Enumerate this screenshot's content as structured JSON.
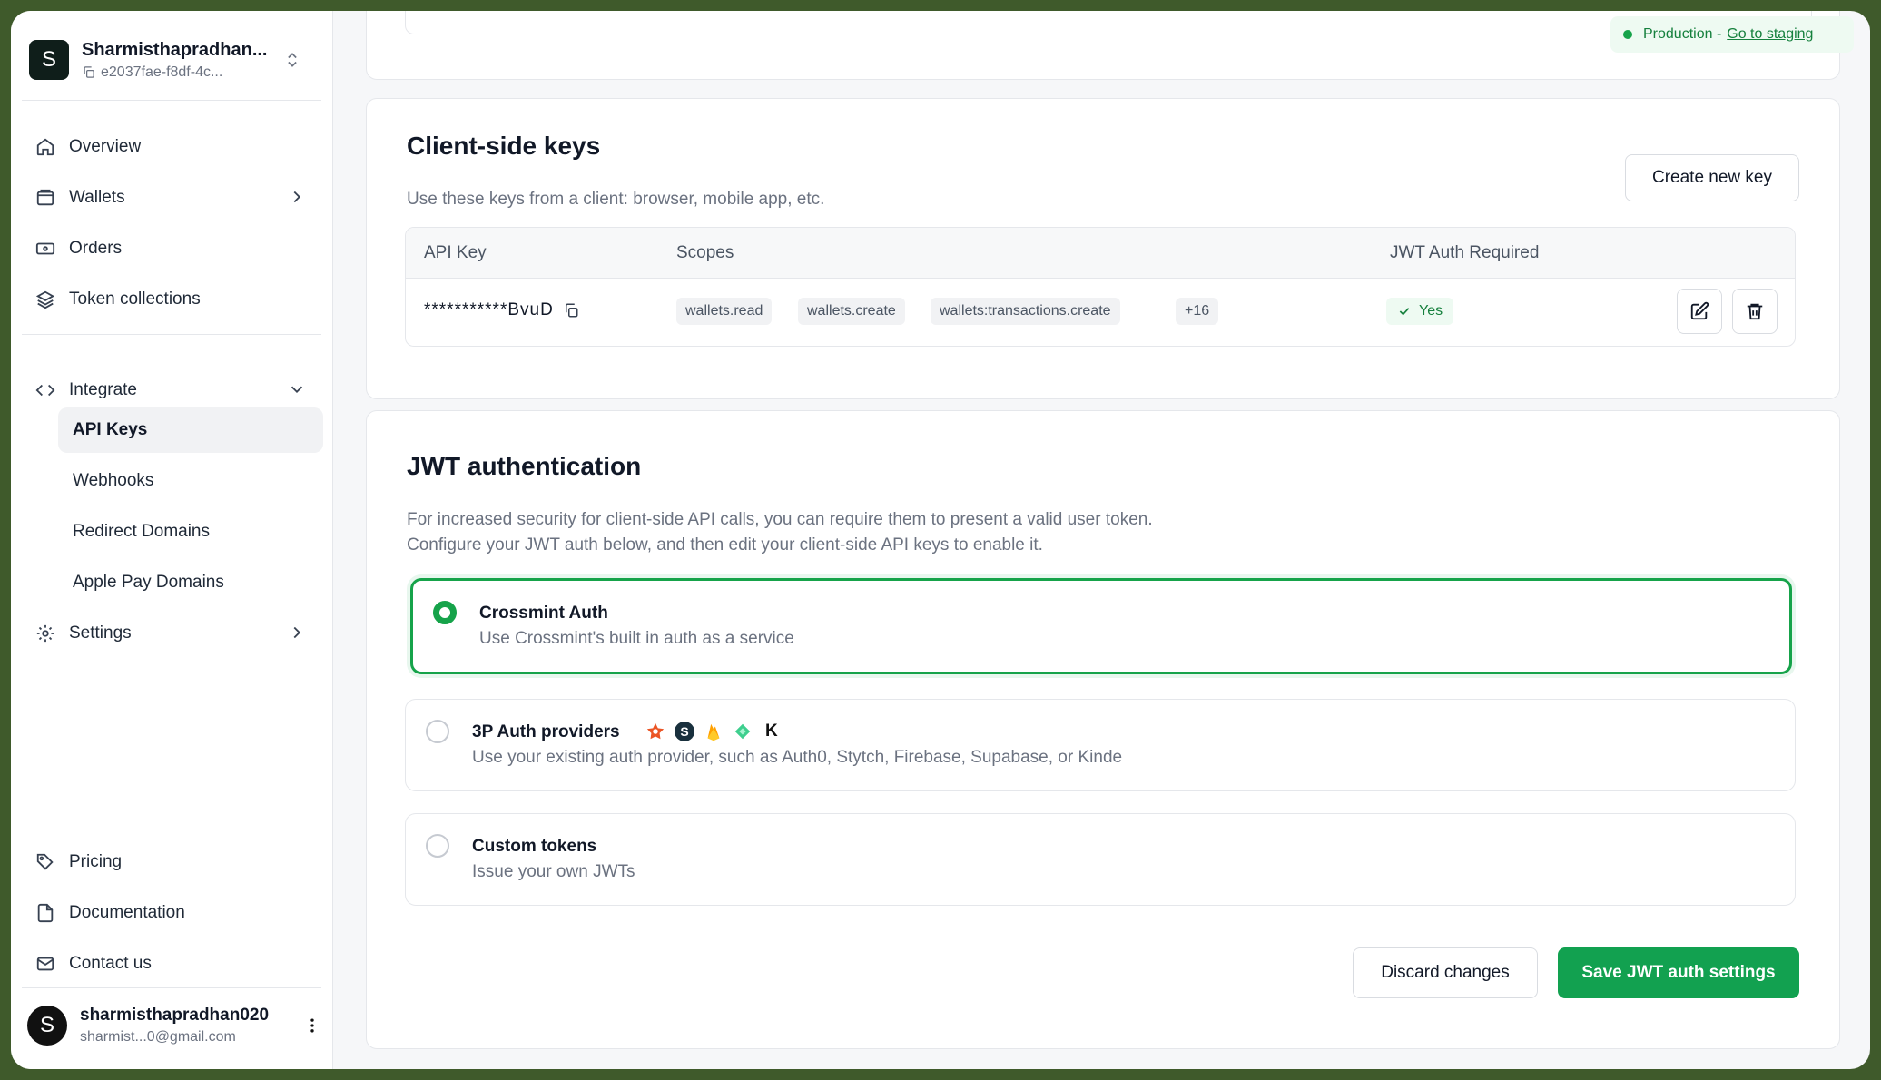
{
  "org": {
    "avatar": "S",
    "name": "Sharmisthapradhan...",
    "id": "e2037fae-f8df-4c..."
  },
  "nav": {
    "overview": "Overview",
    "wallets": "Wallets",
    "orders": "Orders",
    "token_collections": "Token collections",
    "integrate": "Integrate",
    "sub": {
      "api_keys": "API Keys",
      "webhooks": "Webhooks",
      "redirect_domains": "Redirect Domains",
      "apple_pay_domains": "Apple Pay Domains"
    },
    "settings": "Settings",
    "pricing": "Pricing",
    "documentation": "Documentation",
    "contact": "Contact us"
  },
  "user": {
    "avatar": "S",
    "name": "sharmisthapradhan020",
    "email": "sharmist...0@gmail.com"
  },
  "env": {
    "label": "Production -",
    "link": "Go to staging"
  },
  "client_keys": {
    "title": "Client-side keys",
    "subtitle": "Use these keys from a client: browser, mobile app, etc.",
    "create_button": "Create new key",
    "columns": [
      "API Key",
      "Scopes",
      "JWT Auth Required"
    ],
    "rows": [
      {
        "key": "***********BvuD",
        "scopes": [
          "wallets.read",
          "wallets.create",
          "wallets:transactions.create",
          "+16"
        ],
        "jwt_required": "Yes"
      }
    ]
  },
  "jwt": {
    "title": "JWT authentication",
    "desc_line1": "For increased security for client-side API calls, you can require them to present a valid user token.",
    "desc_line2": "Configure your JWT auth below, and then edit your client-side API keys to enable it.",
    "options": [
      {
        "title": "Crossmint Auth",
        "desc": "Use Crossmint's built in auth as a service",
        "selected": true
      },
      {
        "title": "3P Auth providers",
        "desc": "Use your existing auth provider, such as Auth0, Stytch, Firebase, Supabase, or Kinde",
        "selected": false
      },
      {
        "title": "Custom tokens",
        "desc": "Issue your own JWTs",
        "selected": false
      }
    ],
    "provider_k": "K",
    "provider_s": "S",
    "discard_button": "Discard changes",
    "save_button": "Save JWT auth settings"
  },
  "colors": {
    "accent": "#12a150",
    "success_bg": "#eefaf2"
  }
}
